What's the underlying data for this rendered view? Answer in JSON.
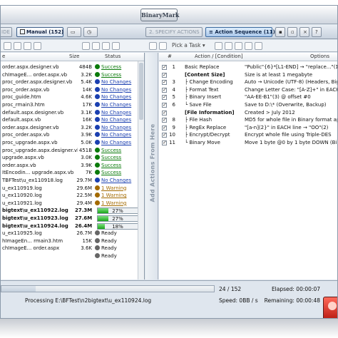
{
  "app": {
    "logo_text": "BinaryMark"
  },
  "topbar": {
    "guide_label": "IDE",
    "manual_label": "Manual (152)",
    "specify_label": "2. SPECIFY ACTIONS",
    "sequence_label": "Action Sequence (11)"
  },
  "subbar": {
    "pick_task_label": "Pick a Task"
  },
  "files": {
    "columns": {
      "name": "e",
      "size": "Size",
      "status": "Status"
    },
    "rows": [
      {
        "name": "order.aspx.designer.vb",
        "size": "484B",
        "status": "Success",
        "kind": "ok"
      },
      {
        "name": "chImageE...     order.aspx.vb",
        "size": "3.2K",
        "status": "Success",
        "kind": "ok"
      },
      {
        "name": "proc_order.aspx.designer.vb",
        "size": "5.4K",
        "status": "No Changes",
        "kind": "nc"
      },
      {
        "name": "proc_order.aspx.vb",
        "size": "14K",
        "status": "No Changes",
        "kind": "nc"
      },
      {
        "name": "proc_guide.htm",
        "size": "4.6K",
        "status": "No Changes",
        "kind": "nc"
      },
      {
        "name": "proc_rmain3.htm",
        "size": "17K",
        "status": "No Changes",
        "kind": "nc"
      },
      {
        "name": "default.aspx.designer.vb",
        "size": "3.1K",
        "status": "No Changes",
        "kind": "nc"
      },
      {
        "name": "default.aspx.vb",
        "size": "16K",
        "status": "No Changes",
        "kind": "nc"
      },
      {
        "name": "order.aspx.designer.vb",
        "size": "3.2K",
        "status": "No Changes",
        "kind": "nc"
      },
      {
        "name": "proc_order.aspx.vb",
        "size": "3.9K",
        "status": "No Changes",
        "kind": "nc"
      },
      {
        "name": "proc_upgrade.aspx.vb",
        "size": "5.0K",
        "status": "No Changes",
        "kind": "nc"
      },
      {
        "name": "proc_upgrade.aspx.designer.vb",
        "size": "451B",
        "status": "Success",
        "kind": "ok"
      },
      {
        "name": "upgrade.aspx.vb",
        "size": "3.0K",
        "status": "Success",
        "kind": "ok"
      },
      {
        "name": "order.aspx.vb",
        "size": "3.9K",
        "status": "Success",
        "kind": "ok"
      },
      {
        "name": "ItEncodin...      upgrade.aspx.vb",
        "size": "7K",
        "status": "Success",
        "kind": "ok"
      },
      {
        "name": "TBFTest\\u_ex110918.log",
        "size": "29.7M",
        "status": "No Changes",
        "kind": "nc"
      },
      {
        "name": "u_ex110919.log",
        "size": "29.6M",
        "status": "1 Warning",
        "kind": "warn"
      },
      {
        "name": "u_ex110920.log",
        "size": "22.5M",
        "status": "1 Warning",
        "kind": "warn"
      },
      {
        "name": "u_ex110921.log",
        "size": "29.4M",
        "status": "1 Warning",
        "kind": "warn"
      },
      {
        "name": "bigtext\\u_ex110922.log",
        "size": "27.3M",
        "status": "27%",
        "kind": "prog",
        "progress": 27
      },
      {
        "name": "bigtext\\u_ex110923.log",
        "size": "27.6M",
        "status": "27%",
        "kind": "prog",
        "progress": 27
      },
      {
        "name": "bigtext\\u_ex110924.log",
        "size": "26.4M",
        "status": "18%",
        "kind": "prog",
        "progress": 18
      },
      {
        "name": "u_ex110925.log",
        "size": "26.7M",
        "status": "Ready",
        "kind": "ready"
      },
      {
        "name": "hImageEn...      rmain3.htm",
        "size": "15K",
        "status": "Ready",
        "kind": "ready"
      },
      {
        "name": "chImageE...      order.aspx",
        "size": "3.6K",
        "status": "Ready",
        "kind": "ready"
      },
      {
        "name": "",
        "size": "",
        "status": "Ready",
        "kind": "ready"
      }
    ]
  },
  "side_panel": {
    "label": "Add Actions From Here"
  },
  "actions": {
    "columns": {
      "num": "#",
      "action": "Action / [Condition]",
      "options": "Options"
    },
    "rows": [
      {
        "num": "1",
        "action": "Basic Replace",
        "option": "\"Public\"{6}*[L1-END] → \"replace...\"(11)",
        "checked": true,
        "bold": false
      },
      {
        "num": "",
        "action": "[Content Size]",
        "option": "Size is at least 1 megabyte",
        "checked": true,
        "bold": true
      },
      {
        "num": "3",
        "action": "├ Change Encoding",
        "option": "Auto → Unicode (UTF-8) (Headers, BigEn...",
        "checked": true,
        "bold": false
      },
      {
        "num": "4",
        "action": "├ Format Text",
        "option": "Change Letter Case: \"[A-Z]+\" in EACH line",
        "checked": true,
        "bold": false
      },
      {
        "num": "5",
        "action": "├ Binary Insert",
        "option": "\"AA-EE-B1\"(3) @ offset #0",
        "checked": true,
        "bold": false
      },
      {
        "num": "6",
        "action": "└ Save File",
        "option": "Save to D:\\* (Overwrite, Backup)",
        "checked": true,
        "bold": false
      },
      {
        "num": "",
        "action": "[File Information]",
        "option": "Created > July 2012",
        "checked": true,
        "bold": true
      },
      {
        "num": "8",
        "action": "├ File Hash",
        "option": "MD5 for whole file in Binary format appe...",
        "checked": true,
        "bold": false
      },
      {
        "num": "9",
        "action": "├ RegEx Replace",
        "option": "\"[a-n](2}\" in EACH line → \"OO\"(2)",
        "checked": true,
        "bold": false
      },
      {
        "num": "10",
        "action": "├ Encrypt/Decrypt",
        "option": "Encrypt whole file using Triple-DES",
        "checked": true,
        "bold": false
      },
      {
        "num": "11",
        "action": "└ Binary Move",
        "option": "Move 1 byte @0 by 1 byte DOWN (Bi...",
        "checked": true,
        "bold": false
      }
    ]
  },
  "status": {
    "count": "24 / 152",
    "elapsed": "Elapsed: 00:00:07",
    "processing": "Processing E:\\BFTest\\n2bigtext\\u_ex110924.log",
    "speed": "Speed: 0BB / s",
    "remaining": "Remaining: 00:00:48",
    "overall_progress": 16
  },
  "colors": {
    "success": "#0a7a0a",
    "nochange": "#1a3fb0",
    "warning": "#a36a00",
    "progress": "#1aa61a"
  }
}
